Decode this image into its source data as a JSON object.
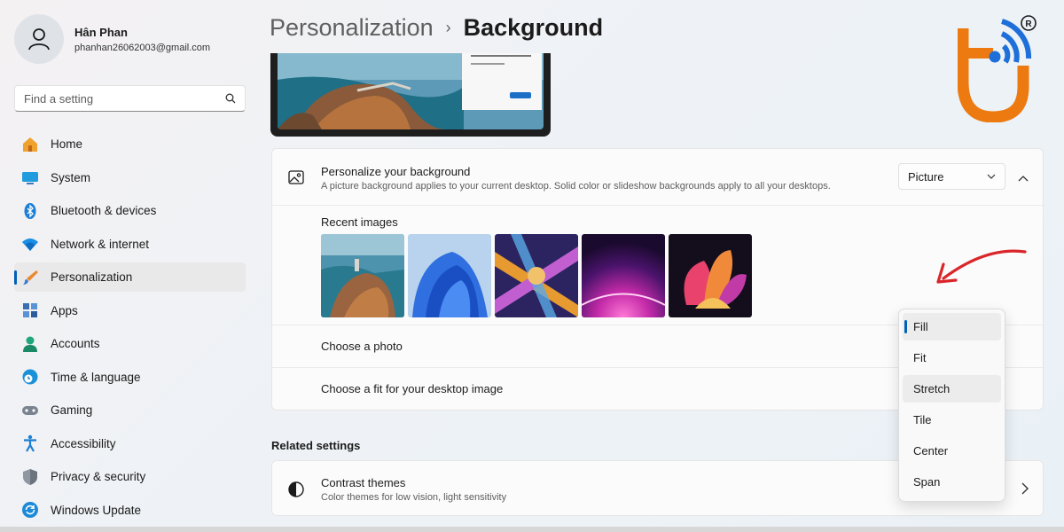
{
  "user": {
    "name": "Hân Phan",
    "email": "phanhan26062003@gmail.com"
  },
  "search": {
    "placeholder": "Find a setting"
  },
  "nav": [
    {
      "label": "Home",
      "icon": "home-icon"
    },
    {
      "label": "System",
      "icon": "system-icon"
    },
    {
      "label": "Bluetooth & devices",
      "icon": "bluetooth-icon"
    },
    {
      "label": "Network & internet",
      "icon": "wifi-icon"
    },
    {
      "label": "Personalization",
      "icon": "brush-icon",
      "active": true
    },
    {
      "label": "Apps",
      "icon": "apps-icon"
    },
    {
      "label": "Accounts",
      "icon": "person-icon"
    },
    {
      "label": "Time & language",
      "icon": "clock-globe-icon"
    },
    {
      "label": "Gaming",
      "icon": "gamepad-icon"
    },
    {
      "label": "Accessibility",
      "icon": "accessibility-icon"
    },
    {
      "label": "Privacy & security",
      "icon": "shield-icon"
    },
    {
      "label": "Windows Update",
      "icon": "update-icon"
    }
  ],
  "breadcrumb": {
    "parent": "Personalization",
    "separator": "›",
    "current": "Background"
  },
  "background": {
    "title": "Personalize your background",
    "subtitle": "A picture background applies to your current desktop. Solid color or slideshow backgrounds apply to all your desktops.",
    "dropdown_value": "Picture",
    "recent_label": "Recent images",
    "recent_images": [
      "coastal-cliffs",
      "blue-bloom",
      "glass-ribbons",
      "purple-glow",
      "abstract-petals"
    ],
    "choose_photo": "Choose a photo",
    "choose_fit": "Choose a fit for your desktop image"
  },
  "related": {
    "title": "Related settings",
    "contrast_title": "Contrast themes",
    "contrast_sub": "Color themes for low vision, light sensitivity"
  },
  "fit_menu": {
    "options": [
      "Fill",
      "Fit",
      "Stretch",
      "Tile",
      "Center",
      "Span"
    ],
    "selected": "Fill",
    "hovered": "Stretch"
  },
  "colors": {
    "accent": "#005fb8",
    "logo_orange": "#ec7a10",
    "logo_blue": "#1e6fd9",
    "arrow_red": "#d9262b"
  }
}
